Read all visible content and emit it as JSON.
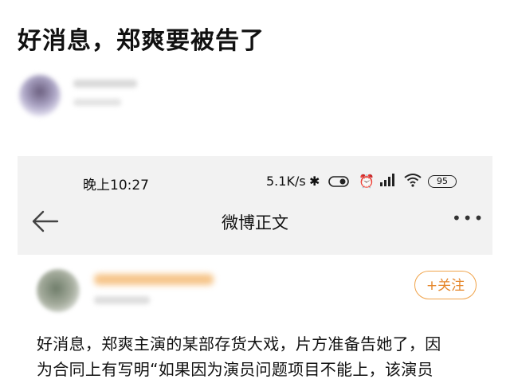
{
  "article": {
    "title": "好消息，郑爽要被告了"
  },
  "status_bar": {
    "time": "晚上10:27",
    "network_speed": "5.1K/s",
    "battery": "95"
  },
  "nav": {
    "title": "微博正文"
  },
  "post": {
    "follow_label": "+关注",
    "text_line1": "好消息，郑爽主演的某部存货大戏，片方准备告她了，因",
    "text_line2": "为合同上有写明“如果因为演员问题项目不能上，该演员"
  },
  "colors": {
    "follow_accent": "#e5862a"
  }
}
